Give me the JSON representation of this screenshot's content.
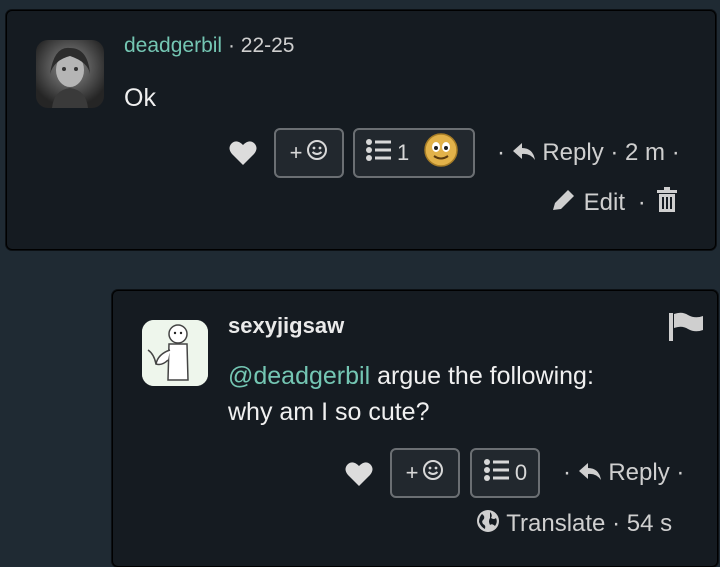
{
  "comment1": {
    "username": "deadgerbil",
    "meta": "· 22-25",
    "text": "Ok",
    "react_label": "+",
    "list_count": "1",
    "reply_label": "Reply",
    "reply_time": "· 2 m ·",
    "edit_label": "Edit"
  },
  "comment2": {
    "username": "sexyjigsaw",
    "mention": "@deadgerbil",
    "text": " argue the following: why am I so cute?",
    "react_label": "+",
    "list_count": "0",
    "reply_label": "Reply",
    "translate_label": "Translate",
    "time": "· 54 s"
  },
  "colors": {
    "accent": "#74c6b3",
    "card_bg": "#151b21",
    "page_bg": "#1f2a33"
  }
}
